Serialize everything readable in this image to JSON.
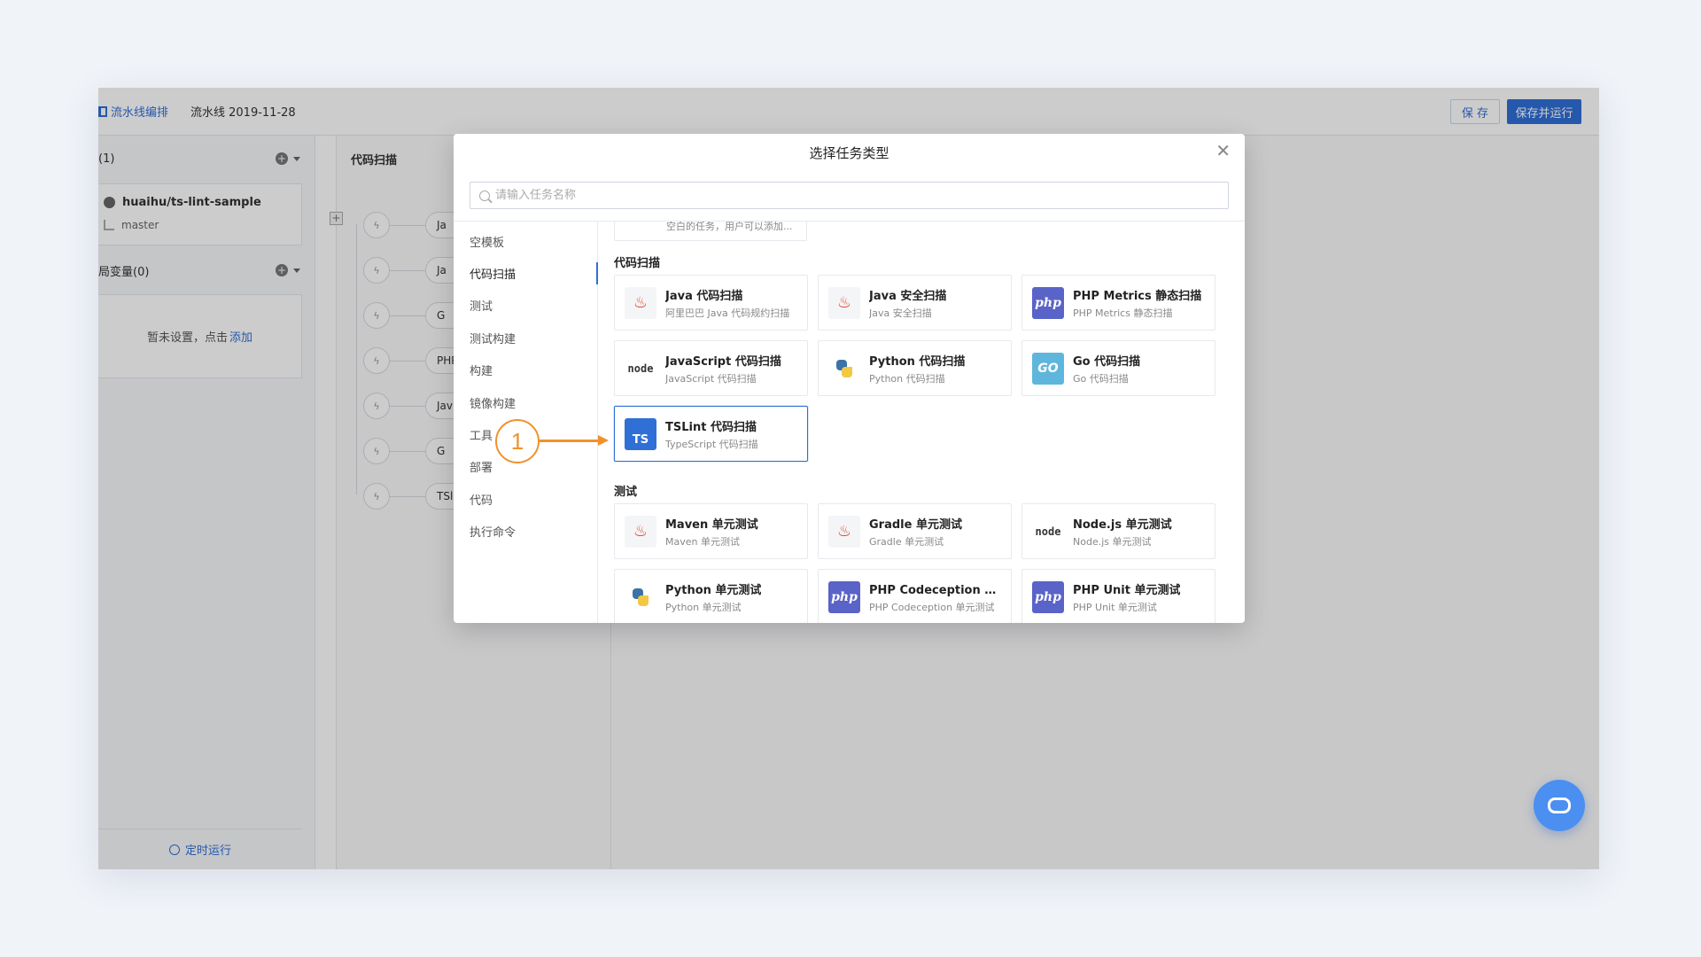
{
  "header": {
    "pipeline_tab": "流水线编排",
    "pipeline_name": "流水线 2019-11-28",
    "save_label": "保 存",
    "save_run_label": "保存并运行"
  },
  "sidebar": {
    "sources_label": "(1)",
    "repo_name": "huaihu/ts-lint-sample",
    "branch": "master",
    "variables_label": "局变量(0)",
    "empty_text": "暂未设置，点击",
    "add_link": "添加",
    "schedule_label": "定时运行"
  },
  "stage": {
    "title": "代码扫描",
    "tasks": [
      "Ja",
      "Ja",
      "G",
      "PHP",
      "Jav",
      "G",
      "TSl"
    ]
  },
  "modal": {
    "title": "选择任务类型",
    "search_placeholder": "请输入任务名称",
    "categories": [
      "空模板",
      "代码扫描",
      "测试",
      "测试构建",
      "构建",
      "镜像构建",
      "工具",
      "部署",
      "代码",
      "执行命令"
    ],
    "active_category": "代码扫描",
    "partial_card_desc": "空白的任务，用户可以添加...",
    "sections": [
      {
        "title": "代码扫描",
        "cards": [
          {
            "name": "Java 代码扫描",
            "desc": "阿里巴巴 Java 代码规约扫描",
            "icon": "java-icon",
            "logo_text": "♨"
          },
          {
            "name": "Java 安全扫描",
            "desc": "Java 安全扫描",
            "icon": "java-icon",
            "logo_text": "♨"
          },
          {
            "name": "PHP Metrics 静态扫描",
            "desc": "PHP Metrics 静态扫描",
            "icon": "php-icon",
            "logo_text": "php"
          },
          {
            "name": "JavaScript 代码扫描",
            "desc": "JavaScript 代码扫描",
            "icon": "nodejs-icon",
            "logo_text": "node"
          },
          {
            "name": "Python 代码扫描",
            "desc": "Python 代码扫描",
            "icon": "python-icon",
            "logo_text": ""
          },
          {
            "name": "Go 代码扫描",
            "desc": "Go 代码扫描",
            "icon": "go-icon",
            "logo_text": "GO"
          },
          {
            "name": "TSLint 代码扫描",
            "desc": "TypeScript 代码扫描",
            "icon": "typescript-icon",
            "logo_text": "TS",
            "selected": true
          }
        ]
      },
      {
        "title": "测试",
        "cards": [
          {
            "name": "Maven 单元测试",
            "desc": "Maven 单元测试",
            "icon": "java-icon",
            "logo_text": "♨"
          },
          {
            "name": "Gradle 单元测试",
            "desc": "Gradle 单元测试",
            "icon": "java-icon",
            "logo_text": "♨"
          },
          {
            "name": "Node.js 单元测试",
            "desc": "Node.js 单元测试",
            "icon": "nodejs-icon",
            "logo_text": "node"
          },
          {
            "name": "Python 单元测试",
            "desc": "Python 单元测试",
            "icon": "python-icon",
            "logo_text": ""
          },
          {
            "name": "PHP Codeception 单元...",
            "desc": "PHP Codeception 单元测试",
            "icon": "php-icon",
            "logo_text": "php"
          },
          {
            "name": "PHP Unit 单元测试",
            "desc": "PHP Unit 单元测试",
            "icon": "php-icon",
            "logo_text": "php"
          }
        ]
      }
    ]
  },
  "annotation": {
    "number": "1"
  },
  "colors": {
    "accent": "#2f6fd6",
    "annotation": "#f0912d",
    "php": "#5a63c8",
    "go": "#5fb6dc"
  }
}
